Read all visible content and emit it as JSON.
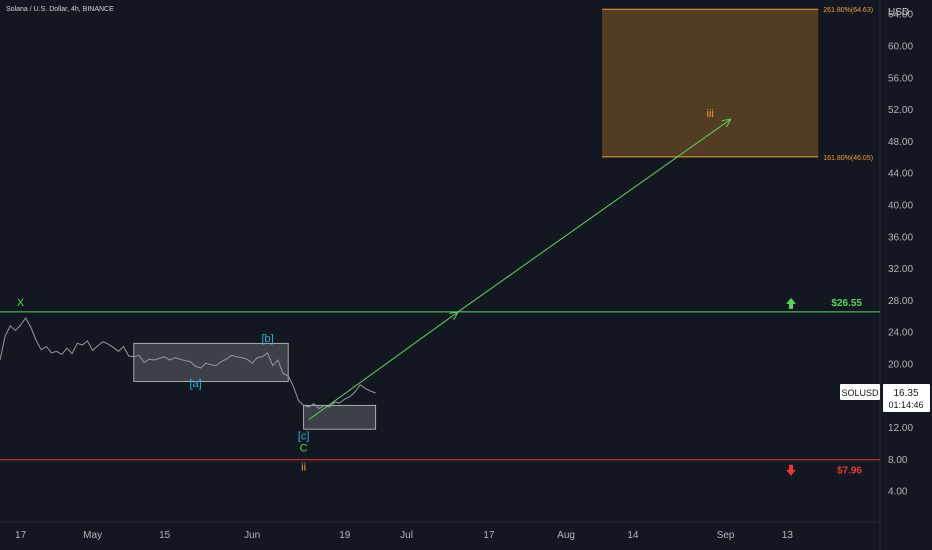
{
  "header": {
    "title": "Solana / U.S. Dollar, 4h, BINANCE"
  },
  "colors": {
    "background": "#131722",
    "price": "#9598a1",
    "green": "#5bd45b",
    "red": "#e53935",
    "orange": "#f0a030",
    "cyan": "#29b6d6",
    "box_fill": "rgba(255,255,255,0.18)",
    "target_fill": "rgba(200,130,40,0.35)"
  },
  "chart_data": {
    "type": "line",
    "title": "Solana / U.S. Dollar, 4h, BINANCE",
    "currency_label": "USD",
    "ylim": [
      3,
      68
    ],
    "y_ticks": [
      4,
      8,
      12,
      16,
      20,
      24,
      28,
      32,
      36,
      40,
      44,
      48,
      52,
      56,
      60,
      64
    ],
    "y_tick_labels": [
      "4.00",
      "8.00",
      "12.00",
      "16.00",
      "20.00",
      "24.00",
      "28.00",
      "32.00",
      "36.00",
      "40.00",
      "44.00",
      "48.00",
      "52.00",
      "56.00",
      "60.00",
      "64.00"
    ],
    "x_axis_range": [
      "2023-04-13",
      "2023-10-01"
    ],
    "x_ticks": [
      {
        "date": "2023-04-17",
        "label": "17"
      },
      {
        "date": "2023-05-01",
        "label": "May"
      },
      {
        "date": "2023-05-15",
        "label": "15"
      },
      {
        "date": "2023-06-01",
        "label": "Jun"
      },
      {
        "date": "2023-06-19",
        "label": "19"
      },
      {
        "date": "2023-07-01",
        "label": "Jul"
      },
      {
        "date": "2023-07-17",
        "label": "17"
      },
      {
        "date": "2023-08-01",
        "label": "Aug"
      },
      {
        "date": "2023-08-14",
        "label": "14"
      },
      {
        "date": "2023-09-01",
        "label": "Sep"
      },
      {
        "date": "2023-09-13",
        "label": "13"
      }
    ],
    "series": [
      {
        "ticker": "SOLUSD",
        "last_price": "16.35",
        "countdown": "01:14:46",
        "points": [
          [
            "2023-04-13",
            20.5
          ],
          [
            "2023-04-14",
            23.5
          ],
          [
            "2023-04-15",
            24.8
          ],
          [
            "2023-04-16",
            24.2
          ],
          [
            "2023-04-17",
            24.9
          ],
          [
            "2023-04-18",
            25.8
          ],
          [
            "2023-04-19",
            24.6
          ],
          [
            "2023-04-20",
            23.0
          ],
          [
            "2023-04-21",
            21.8
          ],
          [
            "2023-04-22",
            22.2
          ],
          [
            "2023-04-23",
            21.4
          ],
          [
            "2023-04-24",
            21.6
          ],
          [
            "2023-04-25",
            21.2
          ],
          [
            "2023-04-26",
            22.0
          ],
          [
            "2023-04-27",
            21.3
          ],
          [
            "2023-04-28",
            22.6
          ],
          [
            "2023-04-29",
            22.4
          ],
          [
            "2023-04-30",
            22.9
          ],
          [
            "2023-05-01",
            21.7
          ],
          [
            "2023-05-02",
            22.3
          ],
          [
            "2023-05-03",
            22.8
          ],
          [
            "2023-05-04",
            22.5
          ],
          [
            "2023-05-05",
            22.1
          ],
          [
            "2023-05-06",
            21.6
          ],
          [
            "2023-05-07",
            22.2
          ],
          [
            "2023-05-08",
            21.0
          ],
          [
            "2023-05-09",
            20.9
          ],
          [
            "2023-05-10",
            21.1
          ],
          [
            "2023-05-11",
            20.2
          ],
          [
            "2023-05-12",
            20.6
          ],
          [
            "2023-05-13",
            20.5
          ],
          [
            "2023-05-14",
            20.7
          ],
          [
            "2023-05-15",
            20.9
          ],
          [
            "2023-05-16",
            20.5
          ],
          [
            "2023-05-17",
            20.8
          ],
          [
            "2023-05-18",
            20.6
          ],
          [
            "2023-05-19",
            20.4
          ],
          [
            "2023-05-20",
            20.3
          ],
          [
            "2023-05-21",
            19.7
          ],
          [
            "2023-05-22",
            19.5
          ],
          [
            "2023-05-23",
            20.1
          ],
          [
            "2023-05-24",
            19.9
          ],
          [
            "2023-05-25",
            19.8
          ],
          [
            "2023-05-26",
            20.3
          ],
          [
            "2023-05-27",
            20.6
          ],
          [
            "2023-05-28",
            21.1
          ],
          [
            "2023-05-29",
            20.9
          ],
          [
            "2023-05-30",
            20.8
          ],
          [
            "2023-05-31",
            20.6
          ],
          [
            "2023-06-01",
            20.1
          ],
          [
            "2023-06-02",
            20.8
          ],
          [
            "2023-06-03",
            20.9
          ],
          [
            "2023-06-04",
            21.4
          ],
          [
            "2023-06-05",
            19.8
          ],
          [
            "2023-06-06",
            20.5
          ],
          [
            "2023-06-07",
            18.8
          ],
          [
            "2023-06-08",
            18.5
          ],
          [
            "2023-06-09",
            17.2
          ],
          [
            "2023-06-10",
            15.4
          ],
          [
            "2023-06-11",
            14.8
          ],
          [
            "2023-06-12",
            14.6
          ],
          [
            "2023-06-13",
            15.0
          ],
          [
            "2023-06-14",
            14.4
          ],
          [
            "2023-06-15",
            14.8
          ],
          [
            "2023-06-16",
            14.6
          ],
          [
            "2023-06-17",
            15.2
          ],
          [
            "2023-06-18",
            15.1
          ],
          [
            "2023-06-19",
            15.6
          ],
          [
            "2023-06-20",
            15.9
          ],
          [
            "2023-06-21",
            16.5
          ],
          [
            "2023-06-22",
            17.4
          ],
          [
            "2023-06-23",
            16.9
          ],
          [
            "2023-06-24",
            16.6
          ],
          [
            "2023-06-25",
            16.35
          ]
        ]
      }
    ],
    "horizontal_lines": [
      {
        "value": 26.55,
        "label": "$26.55",
        "color": "green",
        "arrow": "up"
      },
      {
        "value": 7.96,
        "label": "$7.96",
        "color": "red",
        "arrow": "down"
      }
    ],
    "boxes": [
      {
        "x0": "2023-05-09",
        "x1": "2023-06-08",
        "y0": 17.8,
        "y1": 22.6
      },
      {
        "x0": "2023-06-11",
        "x1": "2023-06-25",
        "y0": 11.8,
        "y1": 14.8
      }
    ],
    "target_zone": {
      "x0": "2023-08-08",
      "x1": "2023-09-19",
      "y0": 46.05,
      "y1": 64.63,
      "upper_label": "261.80%(64.63)",
      "lower_label": "161.80%(46.05)"
    },
    "projection": [
      {
        "x0": "2023-06-12",
        "y0": 13.0,
        "x1": "2023-07-11",
        "y1": 26.55
      },
      {
        "x0": "2023-07-11",
        "y0": 26.55,
        "x1": "2023-09-02",
        "y1": 50.8
      }
    ],
    "annotations": [
      {
        "text": "X",
        "date": "2023-04-17",
        "value": 27.8,
        "color": "green"
      },
      {
        "text": "[b]",
        "date": "2023-06-04",
        "value": 23.3,
        "color": "cyan"
      },
      {
        "text": "[a]",
        "date": "2023-05-21",
        "value": 17.6,
        "color": "cyan"
      },
      {
        "text": "[c]",
        "date": "2023-06-11",
        "value": 11.0,
        "color": "cyan"
      },
      {
        "text": "C",
        "date": "2023-06-11",
        "value": 9.5,
        "color": "green"
      },
      {
        "text": "ii",
        "date": "2023-06-11",
        "value": 7.1,
        "color": "orange"
      },
      {
        "text": "iii",
        "date": "2023-08-29",
        "value": 51.6,
        "color": "orange"
      }
    ]
  }
}
